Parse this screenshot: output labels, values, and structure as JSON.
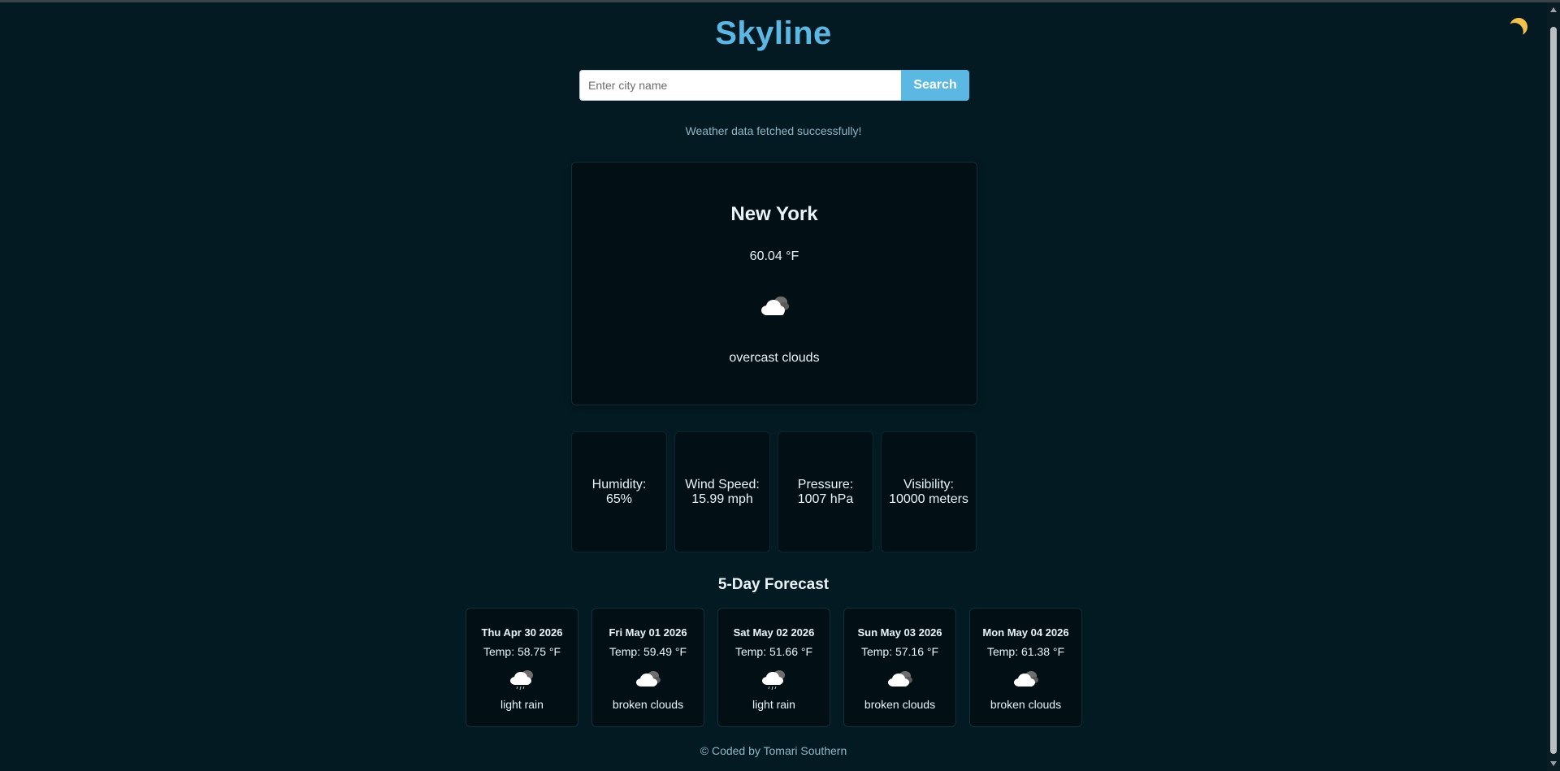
{
  "app": {
    "title": "Skyline",
    "theme_icon": "moon-icon"
  },
  "search": {
    "placeholder": "Enter city name",
    "value": "",
    "button_label": "Search"
  },
  "status_message": "Weather data fetched successfully!",
  "current": {
    "city": "New York",
    "temperature": "60.04 °F",
    "icon": "overcast-clouds-icon",
    "description": "overcast clouds"
  },
  "stats": [
    {
      "label": "Humidity:",
      "value": "65%"
    },
    {
      "label": "Wind Speed:",
      "value": "15.99 mph"
    },
    {
      "label": "Pressure:",
      "value": "1007 hPa"
    },
    {
      "label": "Visibility:",
      "value": "10000 meters"
    }
  ],
  "forecast": {
    "title": "5-Day Forecast",
    "days": [
      {
        "date": "Thu Apr 30 2026",
        "temp": "Temp: 58.75 °F",
        "icon": "light-rain-icon",
        "desc": "light rain"
      },
      {
        "date": "Fri May 01 2026",
        "temp": "Temp: 59.49 °F",
        "icon": "broken-clouds-icon",
        "desc": "broken clouds"
      },
      {
        "date": "Sat May 02 2026",
        "temp": "Temp: 51.66 °F",
        "icon": "light-rain-icon",
        "desc": "light rain"
      },
      {
        "date": "Sun May 03 2026",
        "temp": "Temp: 57.16 °F",
        "icon": "broken-clouds-icon",
        "desc": "broken clouds"
      },
      {
        "date": "Mon May 04 2026",
        "temp": "Temp: 61.38 °F",
        "icon": "broken-clouds-icon",
        "desc": "broken clouds"
      }
    ]
  },
  "footer": "© Coded by Tomari Southern",
  "colors": {
    "background": "#041a22",
    "card": "#020f15",
    "accent": "#5ab8e3",
    "moon": "#f4c24a"
  }
}
